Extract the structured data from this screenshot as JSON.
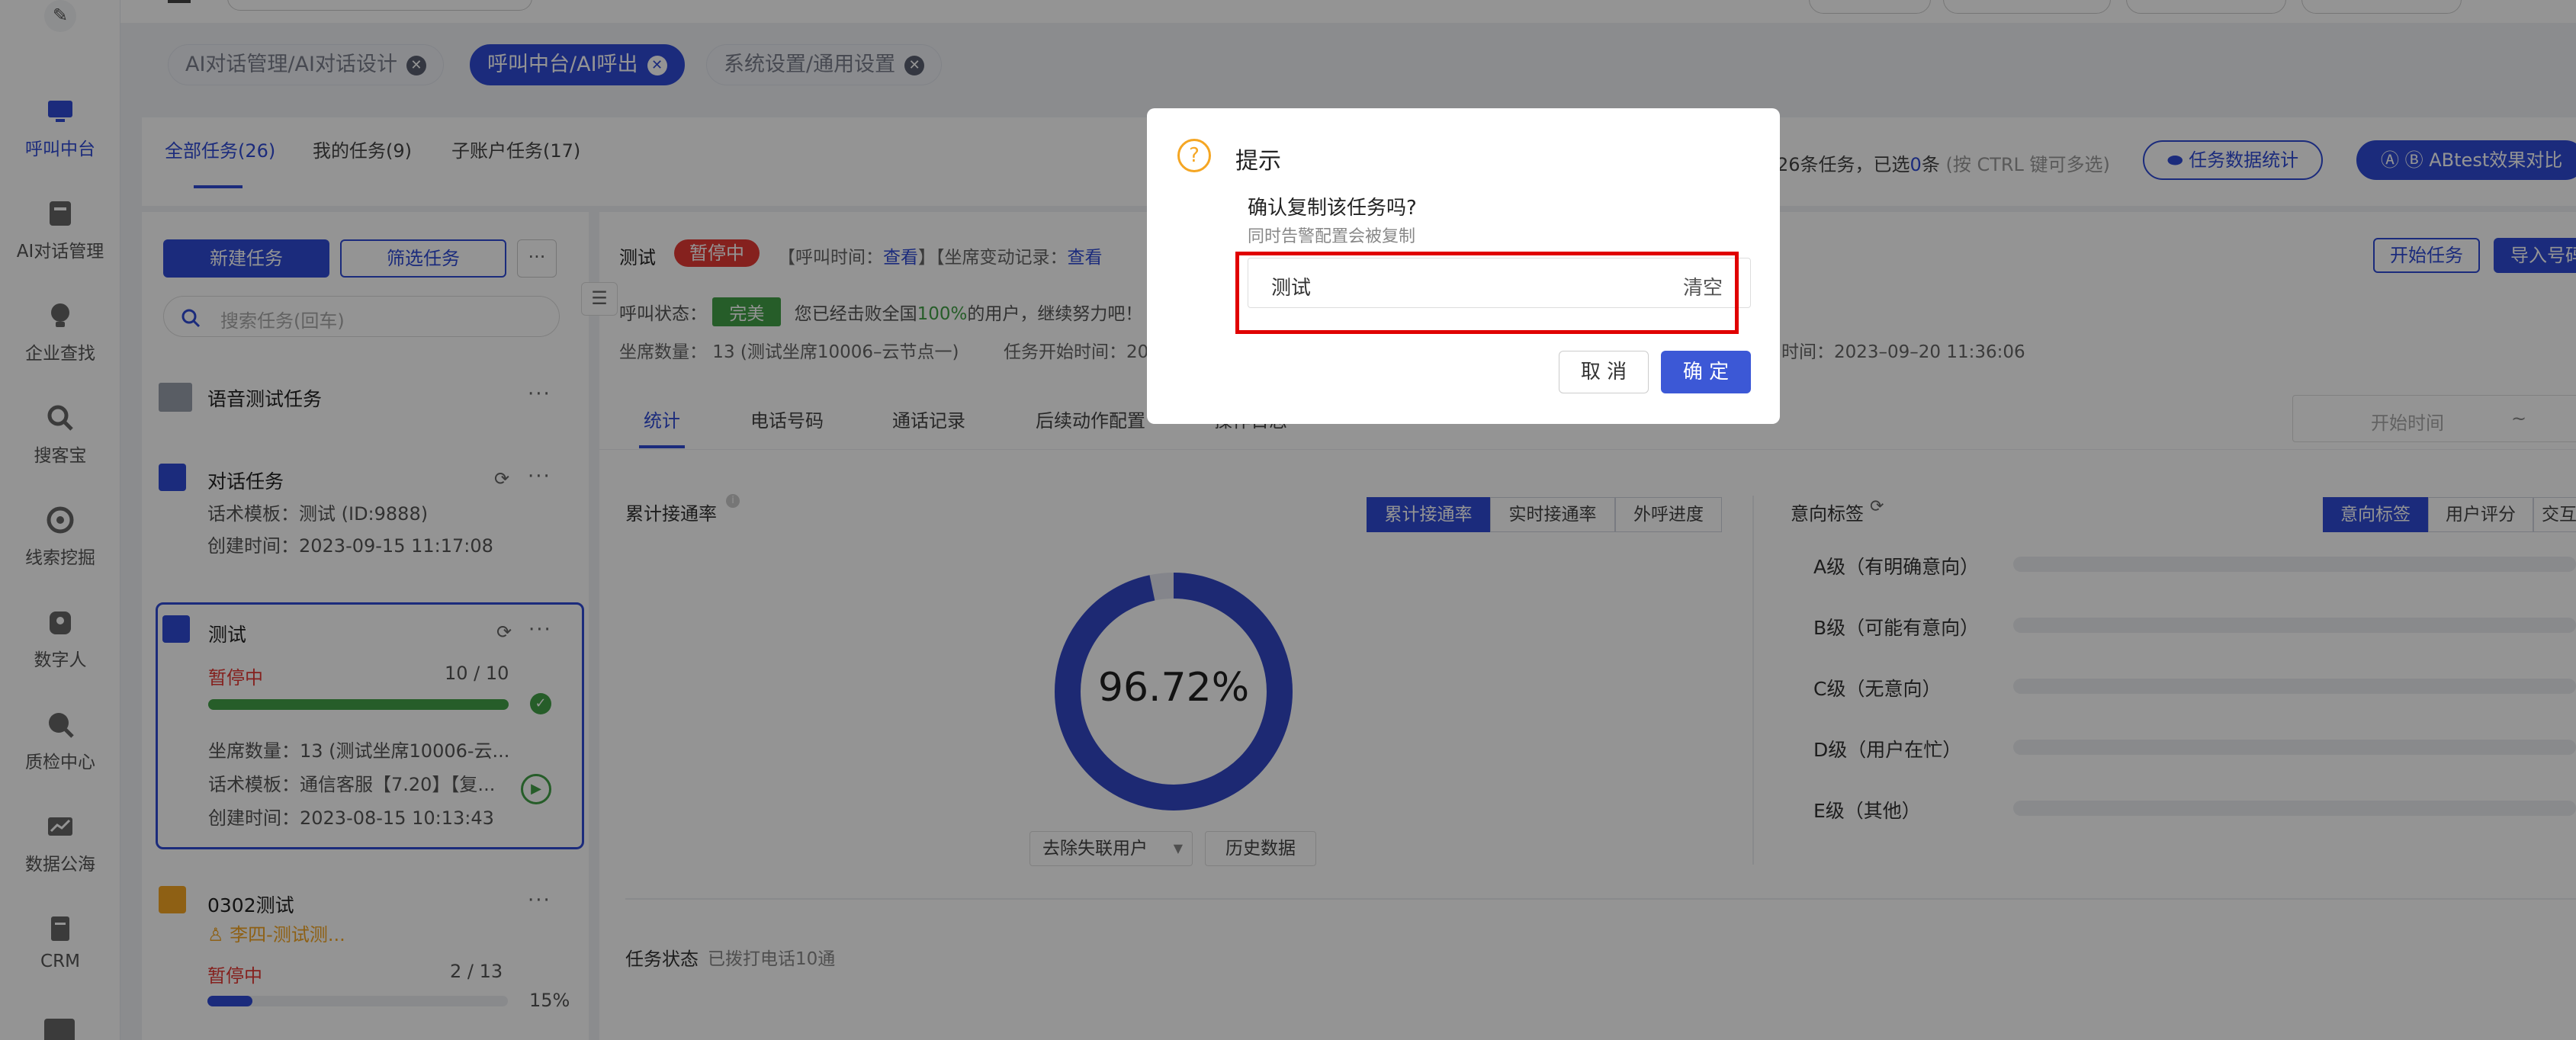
{
  "sidebar": {
    "items": [
      {
        "label": "呼叫中台",
        "icon": "monitor-icon",
        "active": true
      },
      {
        "label": "AI对话管理",
        "icon": "robot-icon",
        "active": false
      },
      {
        "label": "企业查找",
        "icon": "bulb-icon",
        "active": false
      },
      {
        "label": "搜客宝",
        "icon": "search-icon",
        "active": false
      },
      {
        "label": "线索挖掘",
        "icon": "target-icon",
        "active": false
      },
      {
        "label": "数字人",
        "icon": "person-icon",
        "active": false
      },
      {
        "label": "质检中心",
        "icon": "inspect-icon",
        "active": false
      },
      {
        "label": "数据公海",
        "icon": "chart-icon",
        "active": false
      },
      {
        "label": "CRM",
        "icon": "book-icon",
        "active": false
      }
    ]
  },
  "tabs": [
    {
      "label": "AI对话管理/AI对话设计",
      "active": false
    },
    {
      "label": "呼叫中台/AI呼出",
      "active": true
    },
    {
      "label": "系统设置/通用设置",
      "active": false
    }
  ],
  "left": {
    "tabs": [
      "全部任务(26)",
      "我的任务(9)",
      "子账户任务(17)"
    ],
    "new_task": "新建任务",
    "filter_task": "筛选任务",
    "more": "···",
    "search_placeholder": "搜索任务(回车)",
    "group_title": "语音测试任务",
    "cards": [
      {
        "title": "对话任务",
        "template": "话术模板：测试 (ID:9888)",
        "created": "创建时间：2023-09-15 11:17:08"
      },
      {
        "title": "测试",
        "status": "暂停中",
        "progress_text": "10 / 10",
        "progress": 1.0,
        "seats": "坐席数量：13 (测试坐席10006-云...",
        "template": "话术模板：通信客服【7.20】【复...",
        "created": "创建时间：2023-08-15 10:13:43"
      },
      {
        "title": "0302测试",
        "owner": "李四-测试测...",
        "status": "暂停中",
        "progress_text": "2 / 13",
        "percent": "15%",
        "progress": 0.15
      }
    ]
  },
  "main": {
    "top_info": "26条任务，已选",
    "top_info_count": "0",
    "top_info_unit": "条",
    "top_info_hint": "(按 CTRL 键可多选)",
    "stats_btn": "任务数据统计",
    "abtest_btn": "ABtest效果对比",
    "task_name": "测试",
    "status": "暂停中",
    "call_time_label": "【呼叫时间：",
    "view": "查看",
    "seat_change_label": "】【坐席变动记录：",
    "start_task": "开始任务",
    "import_btn": "导入号码",
    "call_status_label": "呼叫状态：",
    "call_status": "完美",
    "call_msg_a": "您已经击败全国",
    "call_msg_pct": "100%",
    "call_msg_b": "的用户，继续努力吧！",
    "seats": "坐席数量：  13 (测试坐席10006–云节点一)",
    "start_time": "任务开始时间：20",
    "end_time": "时间：2023–09–20 11:36:06",
    "subtabs": [
      "统计",
      "电话号码",
      "通话记录",
      "后续动作配置",
      "操作日志"
    ],
    "date_placeholder": "开始时间",
    "date_sep": "~",
    "rate_title": "累计接通率",
    "rate_pills": [
      "累计接通率",
      "实时接通率",
      "外呼进度"
    ],
    "donut_value": "96.72%",
    "donut_fraction": 0.9672,
    "filter_select": "去除失联用户",
    "history_btn": "历史数据",
    "intent_title": "意向标签",
    "intent_pills": [
      "意向标签",
      "用户评分",
      "交互"
    ],
    "intent_rows": [
      "A级（有明确意向）",
      "B级（可能有意向）",
      "C级（无意向）",
      "D级（用户在忙）",
      "E级（其他）"
    ],
    "task_status_label": "任务状态",
    "task_status_value": "已拨打电话10通"
  },
  "modal": {
    "title": "提示",
    "question": "确认复制该任务吗?",
    "note": "同时告警配置会被复制",
    "input_value": "测试",
    "clear": "清空",
    "cancel": "取 消",
    "confirm": "确 定"
  },
  "colors": {
    "primary": "#2f4bd6",
    "danger": "#e53935",
    "success": "#43a047",
    "warning": "#f5a623"
  }
}
